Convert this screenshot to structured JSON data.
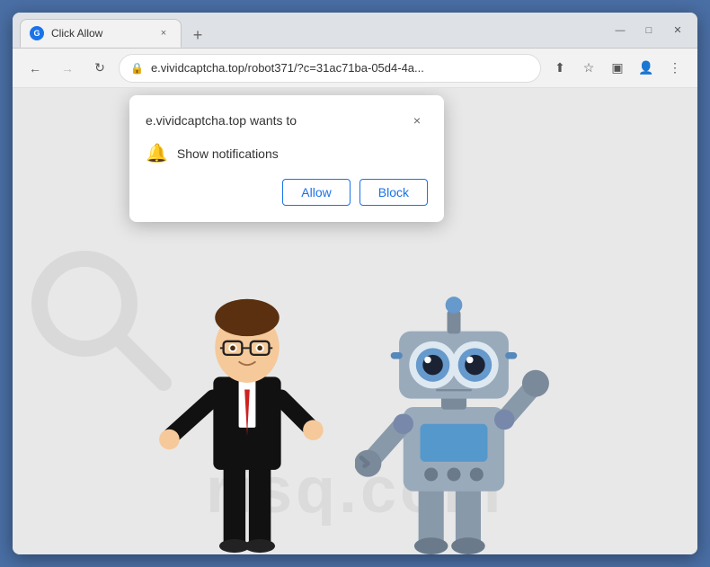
{
  "browser": {
    "tab": {
      "favicon_label": "G",
      "title": "Click Allow",
      "close_label": "×"
    },
    "new_tab_label": "+",
    "window_controls": {
      "minimize": "—",
      "maximize": "□",
      "close": "✕"
    },
    "nav": {
      "back_label": "←",
      "forward_label": "→",
      "refresh_label": "↻",
      "address": "e.vividcaptcha.top/robot371/?c=31ac71ba-05d4-4a...",
      "lock_icon": "🔒",
      "share_icon": "⬆",
      "star_icon": "☆",
      "split_icon": "▣",
      "account_icon": "👤",
      "menu_icon": "⋮"
    },
    "popup": {
      "title": "e.vividcaptcha.top wants to",
      "close_label": "×",
      "notification_label": "Show notifications",
      "allow_label": "Allow",
      "block_label": "Block"
    },
    "watermark": "risq.com"
  }
}
